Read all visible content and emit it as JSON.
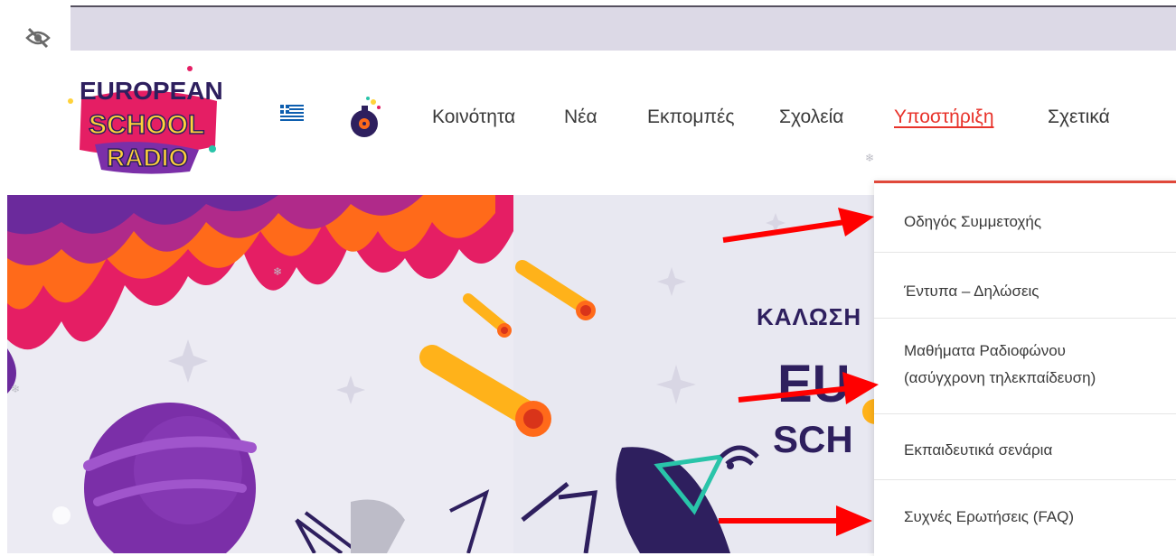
{
  "topbar": {
    "icon": "eye-off-icon"
  },
  "logo": {
    "line1": "EUROPEAN",
    "line2": "SCHOOL",
    "line3": "RADIO"
  },
  "nav": {
    "flag_icon": "greek-flag-icon",
    "radio_icon": "radio-bomb-icon",
    "items": [
      {
        "label": "Κοινότητα"
      },
      {
        "label": "Νέα"
      },
      {
        "label": "Εκπομπές"
      },
      {
        "label": "Σχολεία"
      },
      {
        "label": "Υποστήριξη"
      },
      {
        "label": "Σχετικά"
      }
    ],
    "active_index": 4
  },
  "dropdown": {
    "items": [
      {
        "label": "Οδηγός Συμμετοχής"
      },
      {
        "label": "Έντυπα – Δηλώσεις"
      },
      {
        "label_line1": "Μαθήματα Ραδιοφώνου",
        "label_line2": "(ασύγχρονη τηλεκπαίδευση)"
      },
      {
        "label": "Εκπαιδευτικά σενάρια"
      },
      {
        "label": "Συχνές Ερωτήσεις (FAQ)"
      }
    ]
  },
  "hero": {
    "text1": "ΚΑΛΩΣΗ",
    "text2": "EU",
    "text3": "SCH"
  },
  "colors": {
    "accent": "#e8322a",
    "dark": "#2e1f5e",
    "purple": "#7b2fa8",
    "pink": "#e51e64",
    "orange": "#ff6a1a"
  },
  "annotations": {
    "arrow_color": "#ff0000",
    "arrow_count": 3
  }
}
